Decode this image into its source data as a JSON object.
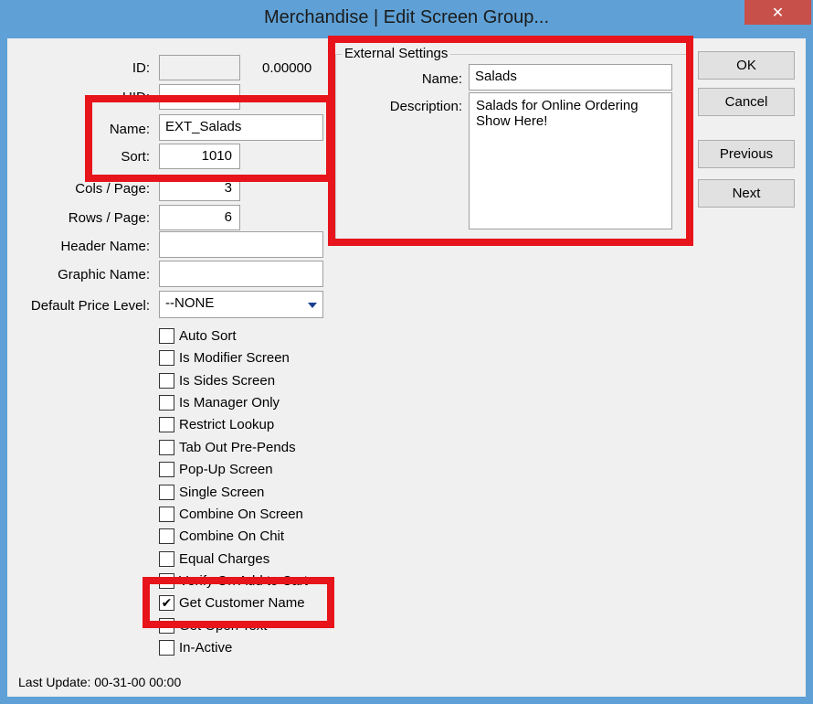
{
  "window": {
    "title": "Merchandise | Edit Screen Group...",
    "close_glyph": "✕"
  },
  "form": {
    "id_label": "ID:",
    "id_value": "",
    "id_number": "0.00000",
    "uid_label": "UID:",
    "name_label": "Name:",
    "name_value": "EXT_Salads",
    "sort_label": "Sort:",
    "sort_value": "1010",
    "cols_label": "Cols / Page:",
    "cols_value": "3",
    "rows_label": "Rows / Page:",
    "rows_value": "6",
    "header_name_label": "Header Name:",
    "header_name_value": "",
    "graphic_name_label": "Graphic Name:",
    "graphic_name_value": "",
    "price_level_label": "Default Price Level:",
    "price_level_value": "--NONE"
  },
  "checkboxes": [
    {
      "label": "Auto Sort",
      "checked": false
    },
    {
      "label": "Is Modifier Screen",
      "checked": false
    },
    {
      "label": "Is Sides Screen",
      "checked": false
    },
    {
      "label": "Is Manager Only",
      "checked": false
    },
    {
      "label": "Restrict Lookup",
      "checked": false
    },
    {
      "label": "Tab Out Pre-Pends",
      "checked": false
    },
    {
      "label": "Pop-Up Screen",
      "checked": false
    },
    {
      "label": "Single Screen",
      "checked": false
    },
    {
      "label": "Combine On Screen",
      "checked": false
    },
    {
      "label": "Combine On Chit",
      "checked": false
    },
    {
      "label": "Equal Charges",
      "checked": false
    },
    {
      "label": "Verify On Add to Cart",
      "checked": false
    },
    {
      "label": "Get Customer Name",
      "checked": true
    },
    {
      "label": "Get Open Text",
      "checked": false
    },
    {
      "label": "In-Active",
      "checked": false
    }
  ],
  "external_settings": {
    "title": "External Settings",
    "name_label": "Name:",
    "name_value": "Salads",
    "description_label": "Description:",
    "description_value": "Salads for Online Ordering Show Here!"
  },
  "buttons": {
    "ok": "OK",
    "cancel": "Cancel",
    "previous": "Previous",
    "next": "Next"
  },
  "footer": {
    "last_update": "Last Update: 00-31-00 00:00"
  },
  "colors": {
    "title_bar": "#5fa1d6",
    "close_button": "#c7504b",
    "highlight": "#e8141b"
  }
}
